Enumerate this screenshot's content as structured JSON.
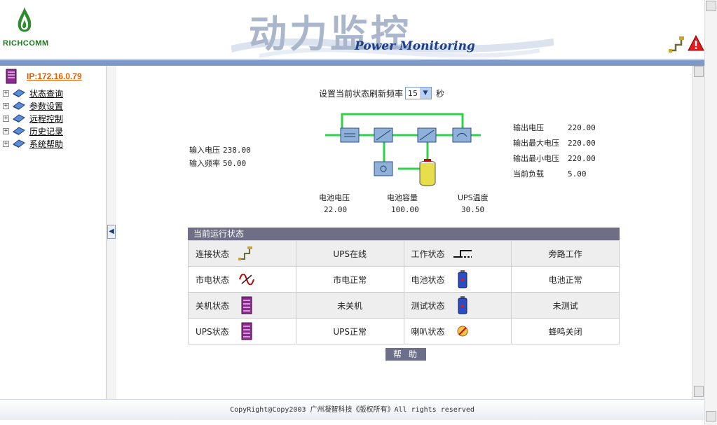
{
  "header": {
    "logo_text": "RICHCOMM",
    "banner_cn": "动力监控",
    "banner_en": "Power Monitoring",
    "accent_green": "#1a7a1a",
    "bar_color": "#7f99c6"
  },
  "sidebar": {
    "ip": "IP:172.16.0.79",
    "items": [
      {
        "label": "状态查询"
      },
      {
        "label": "参数设置"
      },
      {
        "label": "远程控制"
      },
      {
        "label": "历史记录"
      },
      {
        "label": "系统帮助"
      }
    ]
  },
  "refresh": {
    "label": "设置当前状态刷新频率",
    "value": "15",
    "unit": "秒"
  },
  "input": {
    "voltage_label": "输入电压",
    "voltage": "238.00",
    "freq_label": "输入频率",
    "freq": "50.00"
  },
  "output": {
    "voltage_label": "输出电压",
    "voltage": "220.00",
    "max_label": "输出最大电压",
    "max": "220.00",
    "min_label": "输出最小电压",
    "min": "220.00",
    "load_label": "当前负载",
    "load": "5.00"
  },
  "battery": {
    "voltage_label": "电池电压",
    "voltage": "22.00",
    "capacity_label": "电池容量",
    "capacity": "100.00",
    "temp_label": "UPS温度",
    "temp": "30.50"
  },
  "status": {
    "title": "当前运行状态",
    "rows": [
      {
        "l1": "连接状态",
        "v1": "UPS在线",
        "l2": "工作状态",
        "v2": "旁路工作"
      },
      {
        "l1": "市电状态",
        "v1": "市电正常",
        "l2": "电池状态",
        "v2": "电池正常"
      },
      {
        "l1": "关机状态",
        "v1": "未关机",
        "l2": "测试状态",
        "v2": "未测试"
      },
      {
        "l1": "UPS状态",
        "v1": "UPS正常",
        "l2": "喇叭状态",
        "v2": "蜂鸣关闭"
      }
    ]
  },
  "help_label": "帮助",
  "footer": "CopyRight@Copy2003 广州凝智科技《版权所有》All rights reserved"
}
